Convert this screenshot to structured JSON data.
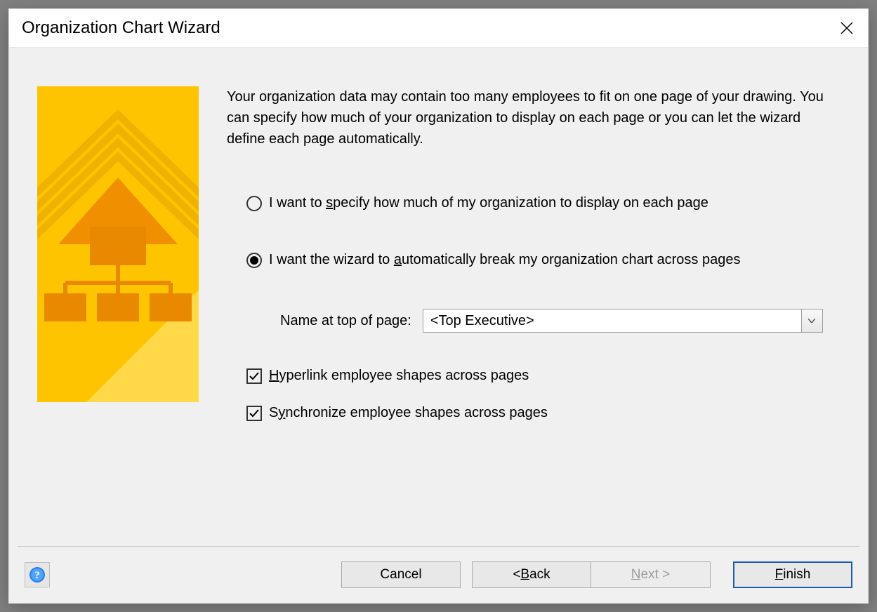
{
  "dialog": {
    "title": "Organization Chart Wizard",
    "intro": "Your organization data may contain too many employees to fit on one page of your drawing. You can specify how much of your organization to display on each page or you can let the wizard define each page automatically."
  },
  "options": {
    "radio_specify_pre": "I want to ",
    "radio_specify_ul": "s",
    "radio_specify_post": "pecify how much of my organization to display on each page",
    "radio_auto_pre": "I want the wizard to ",
    "radio_auto_ul": "a",
    "radio_auto_post": "utomatically break my organization chart across pages",
    "selected": "auto"
  },
  "name_field": {
    "label_pre": "Na",
    "label_ul": "m",
    "label_post": "e at top of page:",
    "value": "<Top Executive>"
  },
  "checkboxes": {
    "hyperlink_ul": "H",
    "hyperlink_post": "yperlink employee shapes across pages",
    "hyperlink_checked": true,
    "sync_pre": "S",
    "sync_ul": "y",
    "sync_post": "nchronize employee shapes across pages",
    "sync_checked": true
  },
  "buttons": {
    "cancel": "Cancel",
    "back_pre": "< ",
    "back_ul": "B",
    "back_post": "ack",
    "next_ul": "N",
    "next_post": "ext >",
    "finish_ul": "F",
    "finish_post": "inish"
  }
}
